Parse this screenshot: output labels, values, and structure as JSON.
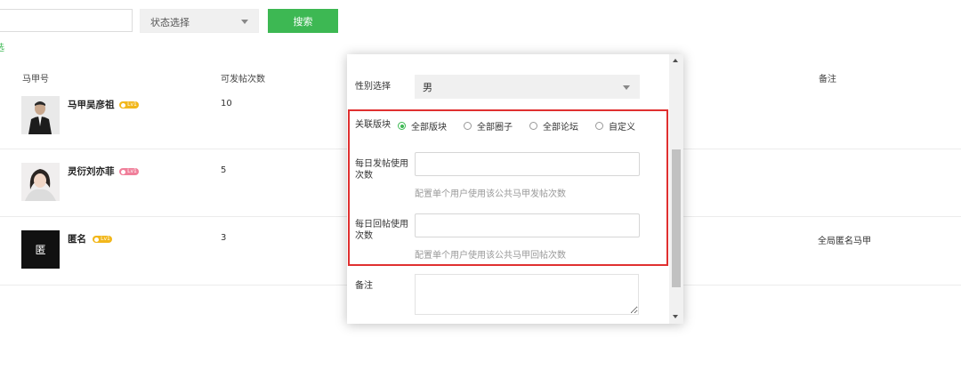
{
  "filters": {
    "search_value": "",
    "status_select": "状态选择",
    "search_button": "搜索",
    "filter_link": "选"
  },
  "table": {
    "headers": [
      "马甲号",
      "可发帖次数",
      "备注"
    ],
    "rows": [
      {
        "name": "马甲吴彦祖",
        "badge": "Lv1",
        "badge_color": "#f2b71b",
        "count": "10",
        "remark": ""
      },
      {
        "name": "灵衍刘亦菲",
        "badge": "Lv1",
        "badge_color": "#f07f9a",
        "count": "5",
        "remark": ""
      },
      {
        "name": "匿名",
        "avatar_text": "匿",
        "badge": "Lv1",
        "badge_color": "#f2b71b",
        "count": "3",
        "remark": "全局匿名马甲"
      }
    ]
  },
  "modal": {
    "gender_label": "性别选择",
    "gender_value": "男",
    "board_label": "关联版块",
    "board_options": [
      "全部版块",
      "全部圈子",
      "全部论坛",
      "自定义"
    ],
    "board_selected": "全部版块",
    "daily_post_label": "每日发帖使用次数",
    "daily_post_value": "",
    "daily_post_hint": "配置单个用户使用该公共马甲发帖次数",
    "daily_reply_label": "每日回帖使用次数",
    "daily_reply_value": "",
    "daily_reply_hint": "配置单个用户使用该公共马甲回帖次数",
    "remark_label": "备注",
    "remark_value": ""
  },
  "colors": {
    "accent": "#3db853",
    "highlight_border": "#e03030"
  }
}
